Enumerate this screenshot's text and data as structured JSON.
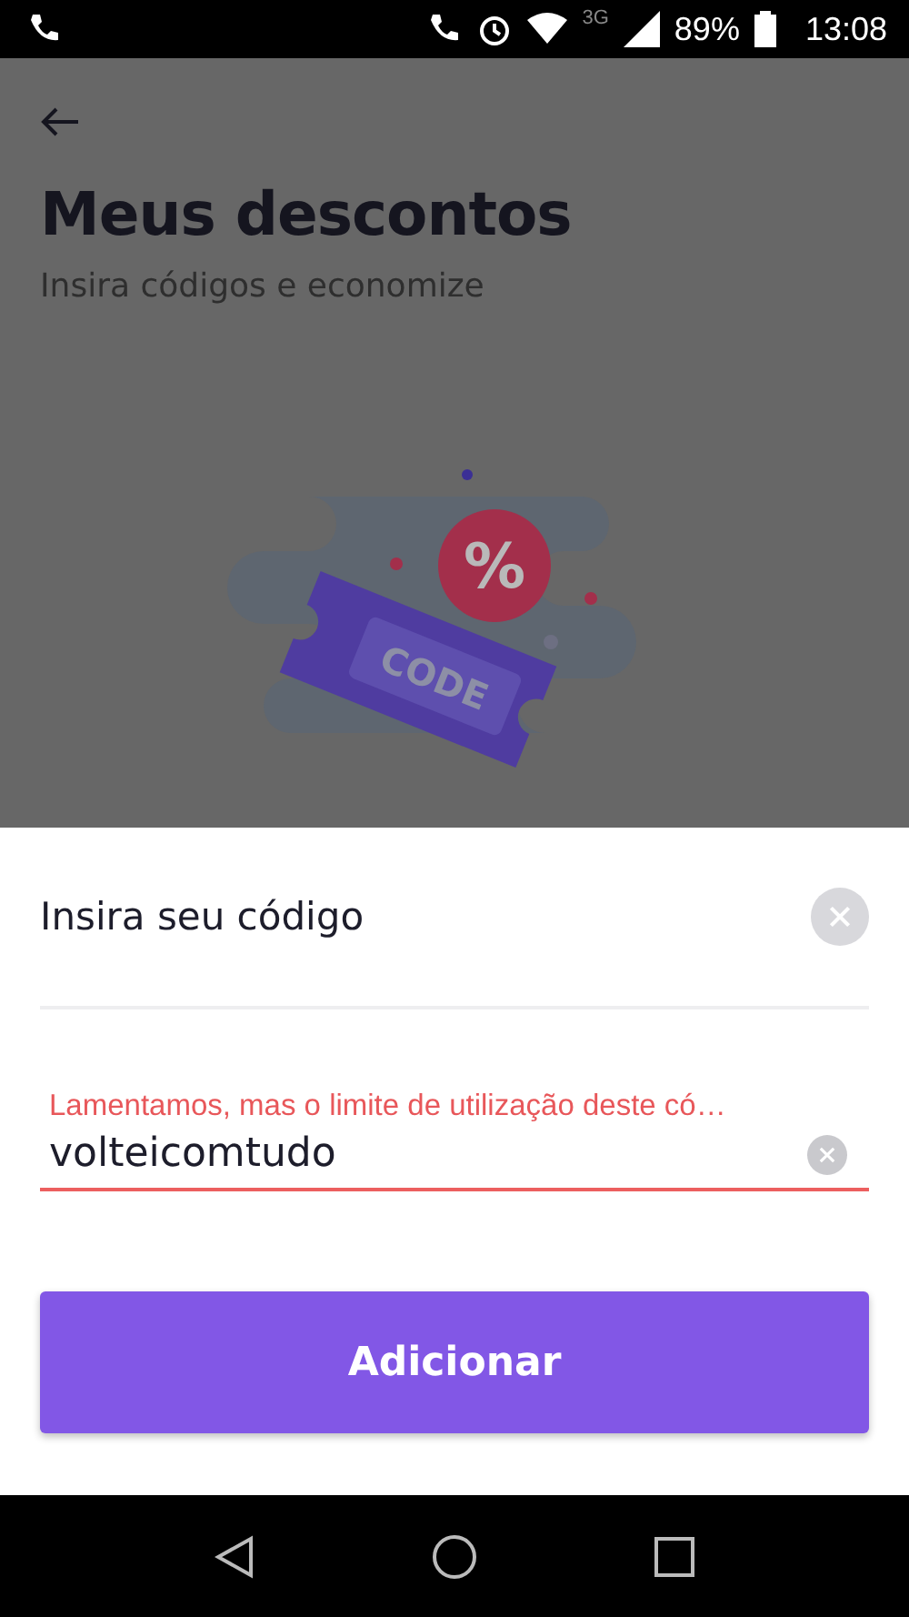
{
  "status_bar": {
    "battery": "89%",
    "network": "3G",
    "time": "13:08"
  },
  "page": {
    "title": "Meus descontos",
    "subtitle": "Insira códigos e economize"
  },
  "illustration": {
    "ticket_label": "CODE",
    "badge": "%"
  },
  "sheet": {
    "title": "Insira seu código",
    "field": {
      "error": true,
      "message": "Lamentamos, mas o limite de utilização deste có…",
      "value": "volteicomtudo"
    },
    "button": "Adicionar"
  }
}
